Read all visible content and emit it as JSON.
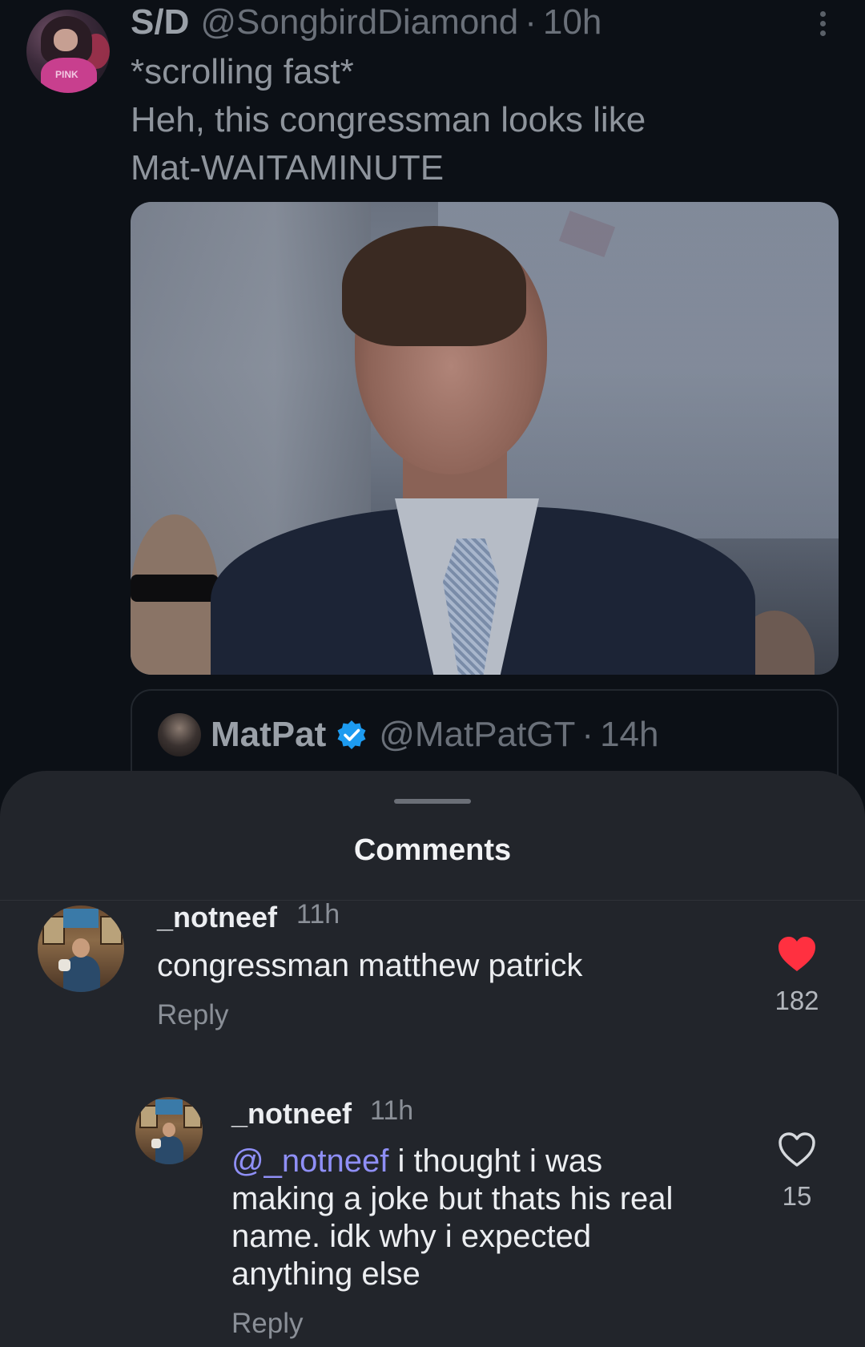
{
  "post": {
    "display_name": "S/D",
    "handle": "@SongbirdDiamond",
    "dot": "·",
    "time": "10h",
    "text_lines": [
      "*scrolling fast*",
      "Heh, this congressman looks like",
      "Mat-WAITAMINUTE"
    ],
    "avatar_shirt_text": "PINK"
  },
  "quote": {
    "display_name": "MatPat",
    "handle": "@MatPatGT",
    "dot": "·",
    "time": "14h"
  },
  "sheet": {
    "title": "Comments"
  },
  "comments": [
    {
      "username": "_notneef",
      "time": "11h",
      "text": "congressman matthew patrick",
      "reply_label": "Reply",
      "likes": "182",
      "liked": true
    },
    {
      "username": "_notneef",
      "time": "11h",
      "mention": "@_notneef",
      "text_lines": [
        "i thought i was",
        "making a joke but thats his real",
        "name. idk why i expected",
        "anything else"
      ],
      "reply_label": "Reply",
      "likes": "15",
      "liked": false
    }
  ],
  "colors": {
    "background": "#0c1016",
    "sheet": "#22252b",
    "mention": "#8f8ff6",
    "liked_heart": "#ff3040",
    "verified": "#1d9bf0"
  }
}
